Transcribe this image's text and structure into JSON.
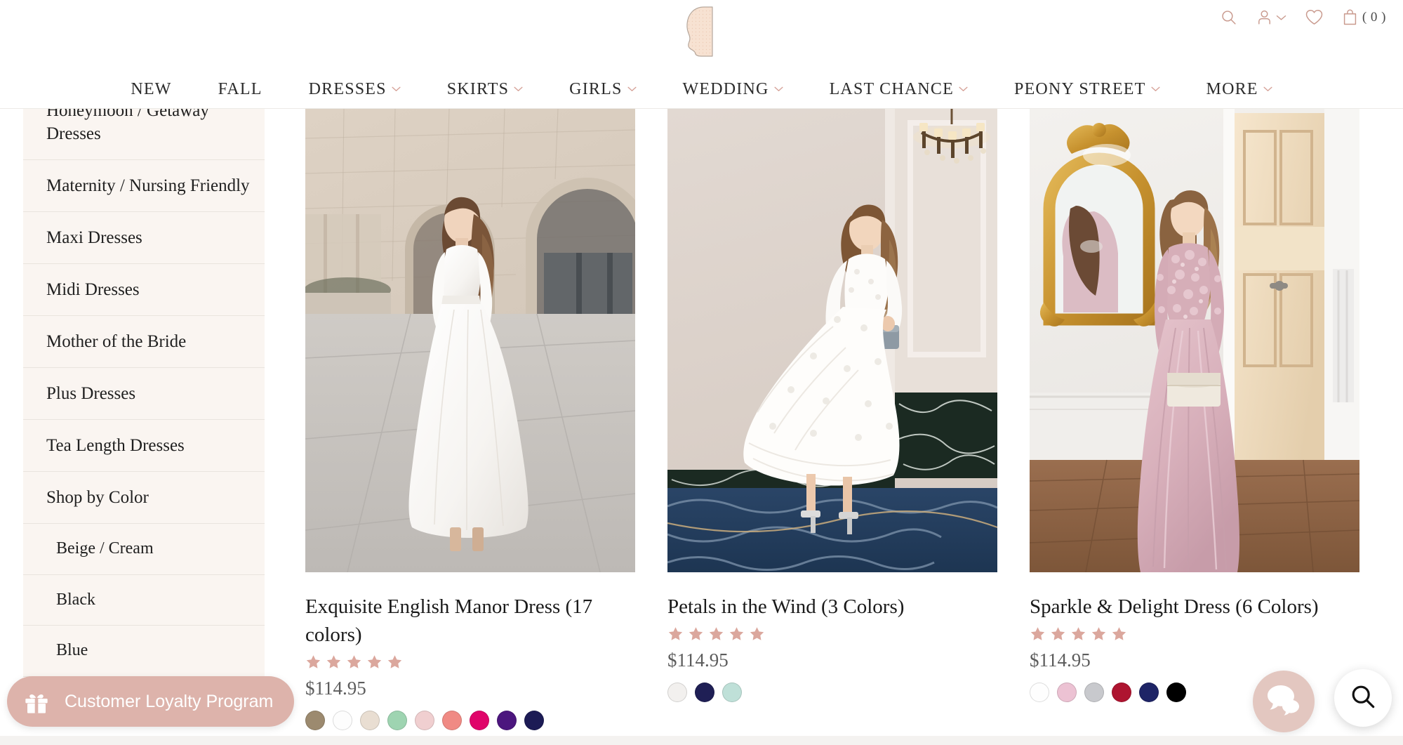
{
  "brand": {
    "logo_icon": "woman-cameo-silhouette-logo",
    "accent_rose": "#c99a8e",
    "pill_rose": "#ddb3ab",
    "star_rose": "#dba79d",
    "sidebar_bg": "#faf5f1"
  },
  "header": {
    "icons": [
      {
        "name": "search-icon",
        "label": "Search"
      },
      {
        "name": "account-icon",
        "label": "Account"
      },
      {
        "name": "chevron-down-icon",
        "label": "Account menu"
      },
      {
        "name": "wishlist-heart-icon",
        "label": "Wishlist"
      },
      {
        "name": "cart-bag-icon",
        "label": "Cart"
      }
    ],
    "cart_count_label": "( 0 )"
  },
  "nav": {
    "items": [
      {
        "label": "NEW",
        "has_dropdown": false
      },
      {
        "label": "FALL",
        "has_dropdown": false
      },
      {
        "label": "DRESSES",
        "has_dropdown": true
      },
      {
        "label": "SKIRTS",
        "has_dropdown": true
      },
      {
        "label": "GIRLS",
        "has_dropdown": true
      },
      {
        "label": "WEDDING",
        "has_dropdown": true
      },
      {
        "label": "LAST CHANCE",
        "has_dropdown": true
      },
      {
        "label": "PEONY STREET",
        "has_dropdown": true
      },
      {
        "label": "MORE",
        "has_dropdown": true
      }
    ]
  },
  "sidebar": {
    "items": [
      {
        "label": "Honeymoon / Getaway Dresses",
        "sub": false
      },
      {
        "label": "Maternity / Nursing Friendly",
        "sub": false
      },
      {
        "label": "Maxi Dresses",
        "sub": false
      },
      {
        "label": "Midi Dresses",
        "sub": false
      },
      {
        "label": "Mother of the Bride",
        "sub": false
      },
      {
        "label": "Plus Dresses",
        "sub": false
      },
      {
        "label": "Tea Length Dresses",
        "sub": false
      },
      {
        "label": "Shop by Color",
        "sub": false
      },
      {
        "label": "Beige / Cream",
        "sub": true
      },
      {
        "label": "Black",
        "sub": true
      },
      {
        "label": "Blue",
        "sub": true
      }
    ]
  },
  "products": [
    {
      "title": "Exquisite English Manor Dress (17 colors)",
      "price": "$114.95",
      "rating": 5,
      "image_alt": "woman-in-white-maxi-dress-by-stone-archway",
      "swatches": [
        {
          "name": "taupe",
          "hex": "#9c8a6f"
        },
        {
          "name": "white",
          "hex": "#fdfdfd"
        },
        {
          "name": "cream",
          "hex": "#e9ded2"
        },
        {
          "name": "mint-green",
          "hex": "#9ed4b1"
        },
        {
          "name": "blush-pink",
          "hex": "#f0cfd0"
        },
        {
          "name": "coral",
          "hex": "#f08a84"
        },
        {
          "name": "magenta",
          "hex": "#e0046a"
        },
        {
          "name": "purple",
          "hex": "#4c167e"
        },
        {
          "name": "navy",
          "hex": "#1c1b55"
        }
      ]
    },
    {
      "title": "Petals in the Wind (3 Colors)",
      "price": "$114.95",
      "rating": 5,
      "image_alt": "woman-in-white-textured-midi-dress-in-hotel-ballroom",
      "swatches": [
        {
          "name": "white",
          "hex": "#f2f0ee"
        },
        {
          "name": "navy",
          "hex": "#1f1f55"
        },
        {
          "name": "seafoam",
          "hex": "#bfe0d8"
        }
      ]
    },
    {
      "title": "Sparkle & Delight Dress (6 Colors)",
      "price": "$114.95",
      "rating": 5,
      "image_alt": "woman-in-blush-pink-gown-by-gold-mirror",
      "swatches": [
        {
          "name": "white",
          "hex": "#fefefe"
        },
        {
          "name": "light-pink",
          "hex": "#ecc2d3"
        },
        {
          "name": "silver-gray",
          "hex": "#c8c9cd"
        },
        {
          "name": "crimson",
          "hex": "#ae1430"
        },
        {
          "name": "navy",
          "hex": "#1e2466"
        },
        {
          "name": "black",
          "hex": "#000000"
        }
      ]
    }
  ],
  "widgets": {
    "loyalty": {
      "label": "Customer Loyalty Program",
      "icon": "gift-icon"
    },
    "chat": {
      "icon": "chat-bubbles-icon",
      "label": "Chat"
    },
    "search_fab": {
      "icon": "search-icon",
      "label": "Search"
    }
  }
}
